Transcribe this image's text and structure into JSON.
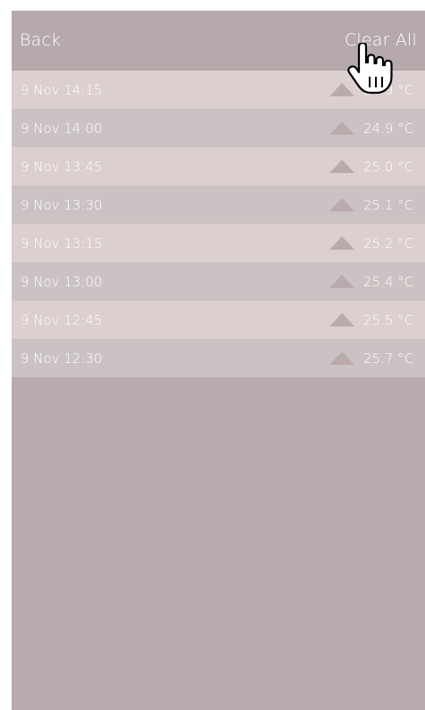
{
  "header": {
    "back_label": "Back",
    "clear_label": "Clear All"
  },
  "readings": [
    {
      "date": "9 Nov 14:15",
      "temp": "24.9 °C",
      "trend": "up"
    },
    {
      "date": "9 Nov 14:00",
      "temp": "24.9 °C",
      "trend": "up"
    },
    {
      "date": "9 Nov 13:45",
      "temp": "25.0 °C",
      "trend": "up"
    },
    {
      "date": "9 Nov 13:30",
      "temp": "25.1 °C",
      "trend": "up"
    },
    {
      "date": "9 Nov 13:15",
      "temp": "25.2 °C",
      "trend": "up"
    },
    {
      "date": "9 Nov 13:00",
      "temp": "25.4 °C",
      "trend": "up"
    },
    {
      "date": "9 Nov 12:45",
      "temp": "25.5 °C",
      "trend": "up"
    },
    {
      "date": "9 Nov 12:30",
      "temp": "25.7 °C",
      "trend": "up"
    }
  ],
  "colors": {
    "background": "#b9abad",
    "row_light": "#dccfcf",
    "row_dark": "#cbc3c3",
    "text": "#ffffff"
  },
  "icons": {
    "trend": "up-triangle-icon",
    "cursor": "hand-pointer-icon"
  }
}
